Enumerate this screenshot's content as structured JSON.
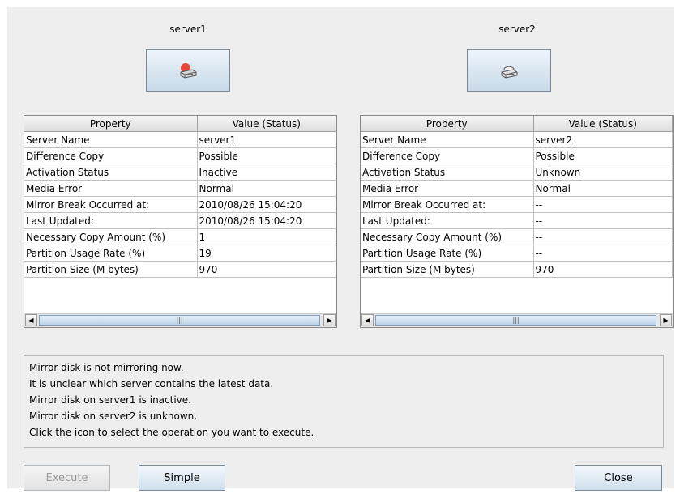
{
  "servers": [
    {
      "title": "server1",
      "icon": "server-disk-inactive-icon",
      "columns": [
        "Property",
        "Value (Status)"
      ],
      "rows": [
        [
          "Server Name",
          "server1"
        ],
        [
          "Difference Copy",
          "Possible"
        ],
        [
          "Activation Status",
          "Inactive"
        ],
        [
          "Media Error",
          "Normal"
        ],
        [
          "Mirror Break Occurred at:",
          "2010/08/26 15:04:20"
        ],
        [
          "Last Updated:",
          "2010/08/26 15:04:20"
        ],
        [
          "Necessary Copy Amount (%)",
          "1"
        ],
        [
          "Partition Usage Rate (%)",
          "19"
        ],
        [
          "Partition Size (M bytes)",
          "970"
        ]
      ]
    },
    {
      "title": "server2",
      "icon": "server-disk-unknown-icon",
      "columns": [
        "Property",
        "Value (Status)"
      ],
      "rows": [
        [
          "Server Name",
          "server2"
        ],
        [
          "Difference Copy",
          "Possible"
        ],
        [
          "Activation Status",
          "Unknown"
        ],
        [
          "Media Error",
          "Normal"
        ],
        [
          "Mirror Break Occurred at:",
          "--"
        ],
        [
          "Last Updated:",
          "--"
        ],
        [
          "Necessary Copy Amount (%)",
          "--"
        ],
        [
          "Partition Usage Rate (%)",
          "--"
        ],
        [
          "Partition Size (M bytes)",
          "970"
        ]
      ]
    }
  ],
  "messages": [
    "Mirror disk is not mirroring now.",
    "It is unclear which server contains the latest data.",
    "Mirror disk on server1 is inactive.",
    "Mirror disk on server2 is unknown.",
    "Click the icon to select the operation you want to execute."
  ],
  "buttons": {
    "execute": "Execute",
    "simple": "Simple",
    "close": "Close"
  },
  "colors": {
    "inactive_status": "#e8453c",
    "button_gradient_top": "#eef5fb",
    "button_gradient_bottom": "#c8d9e8"
  }
}
